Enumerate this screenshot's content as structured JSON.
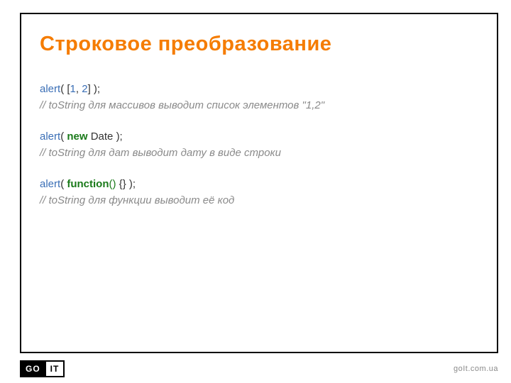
{
  "slide": {
    "title": "Строковое преобразование",
    "code": {
      "line1": {
        "fn": "alert",
        "open": "( [",
        "n1": "1",
        "sep": ", ",
        "n2": "2",
        "close": "] );"
      },
      "comment1": "// toString для массивов выводит список элементов \"1,2\"",
      "line2": {
        "fn": "alert",
        "open": "( ",
        "kw": "new",
        "rest": " Date );"
      },
      "comment2": "// toString для дат выводит дату в виде строки",
      "line3": {
        "fn": "alert",
        "open": "( ",
        "kw": "function",
        "gopen": "(",
        "gclose": ")",
        "rest": " {} );"
      },
      "comment3": "// toString для функции выводит её код"
    }
  },
  "footer": {
    "logo_go": "GO",
    "logo_it": "IT",
    "url": "goIt.com.ua"
  }
}
